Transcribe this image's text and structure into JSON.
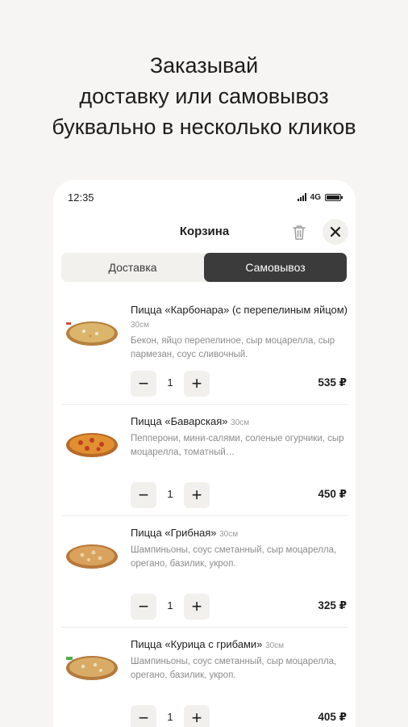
{
  "promo": {
    "line1": "Заказывай",
    "line2": "доставку или самовывоз",
    "line3": "буквально в несколько кликов"
  },
  "status_bar": {
    "time": "12:35",
    "network": "4G"
  },
  "header": {
    "title": "Корзина",
    "icons": [
      "trash-icon",
      "close-icon"
    ]
  },
  "tabs": [
    {
      "label": "Доставка",
      "active": false
    },
    {
      "label": "Самовывоз",
      "active": true
    }
  ],
  "cart": {
    "items": [
      {
        "name": "Пицца «Карбонара» (с перепелиным яйцом)",
        "size": "30см",
        "description": "Бекон, яйцо перепелиное, сыр моцарелла, сыр пармезан, соус сливочный.",
        "quantity": "1",
        "price": "535 ₽"
      },
      {
        "name": "Пицца «Баварская»",
        "size": "30см",
        "description": "Пепперони, мини-салями, соленые огурчики, сыр моцарелла, томатный…",
        "quantity": "1",
        "price": "450 ₽"
      },
      {
        "name": "Пицца «Грибная»",
        "size": "30см",
        "description": "Шампиньоны, соус сметанный, сыр моцарелла, орегано, базилик, укроп.",
        "quantity": "1",
        "price": "325 ₽"
      },
      {
        "name": "Пицца «Курица с грибами»",
        "size": "30см",
        "description": "Шампиньоны, соус сметанный, сыр моцарелла, орегано, базилик, укроп.",
        "quantity": "1",
        "price": "405 ₽"
      }
    ],
    "minus_symbol": "−",
    "plus_symbol": "+"
  }
}
